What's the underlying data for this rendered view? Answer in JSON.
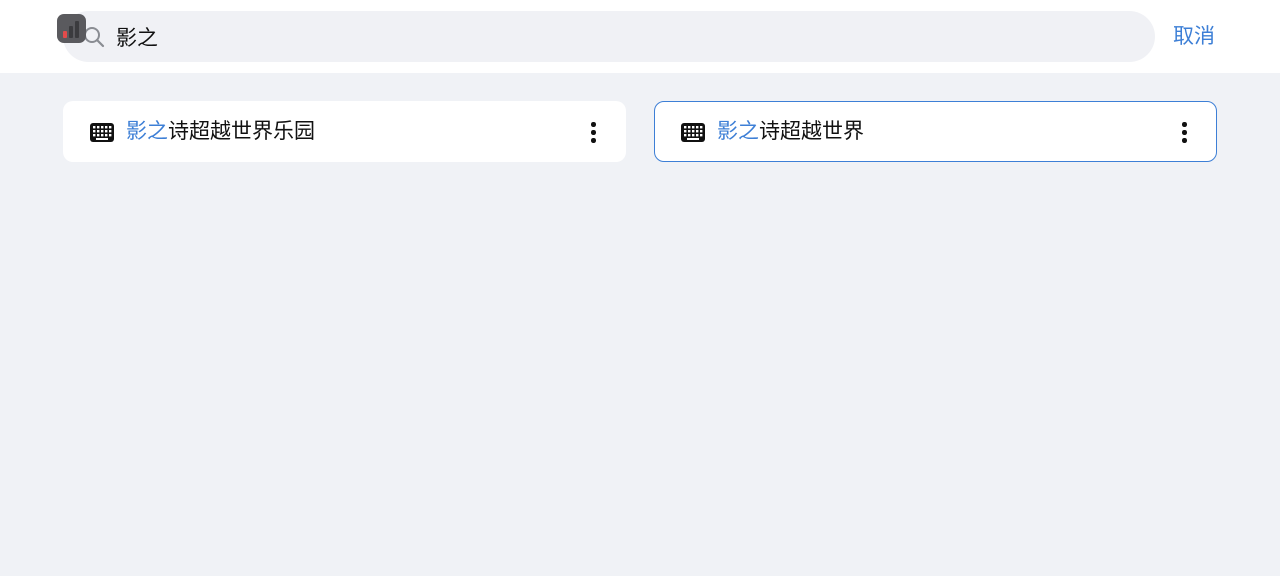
{
  "search": {
    "value": "影之",
    "cancel_label": "取消"
  },
  "results": [
    {
      "highlight": "影之",
      "rest": "诗超越世界乐园",
      "icon": "keyboard-icon",
      "selected": false
    },
    {
      "highlight": "影之",
      "rest": "诗超越世界",
      "icon": "keyboard-icon",
      "selected": true
    }
  ],
  "colors": {
    "accent": "#3d7fd6",
    "background": "#f0f2f6",
    "card": "#ffffff"
  }
}
